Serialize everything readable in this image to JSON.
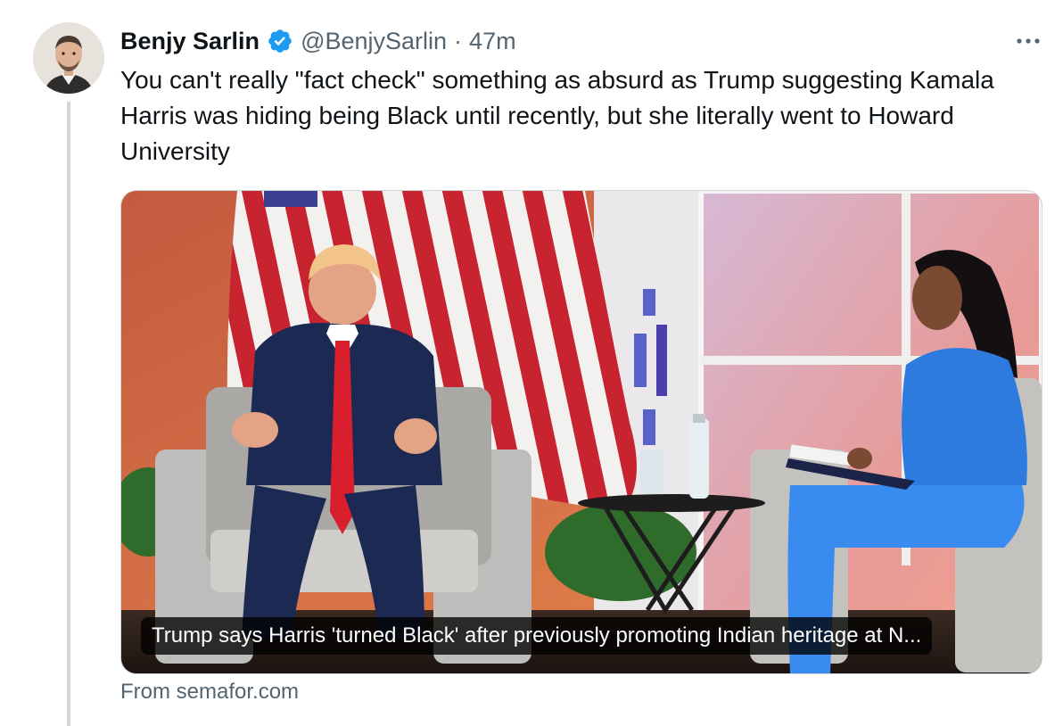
{
  "author": {
    "name": "Benjy Sarlin",
    "handle": "@BenjySarlin",
    "separator": "·",
    "time": "47m",
    "verified": true,
    "avatar_icon": "profile-photo"
  },
  "tweet": {
    "text": "You can't really \"fact check\" something as absurd as Trump suggesting Kamala Harris was hiding being Black until recently, but she literally went to Howard University"
  },
  "link_card": {
    "title": "Trump says Harris 'turned Black' after previously promoting Indian heritage at N...",
    "source": "From semafor.com",
    "image_description_icon": "news-photo"
  },
  "colors": {
    "text_primary": "#0f1419",
    "text_secondary": "#536471",
    "verified_blue": "#1d9bf0",
    "border": "#cfd9de"
  }
}
